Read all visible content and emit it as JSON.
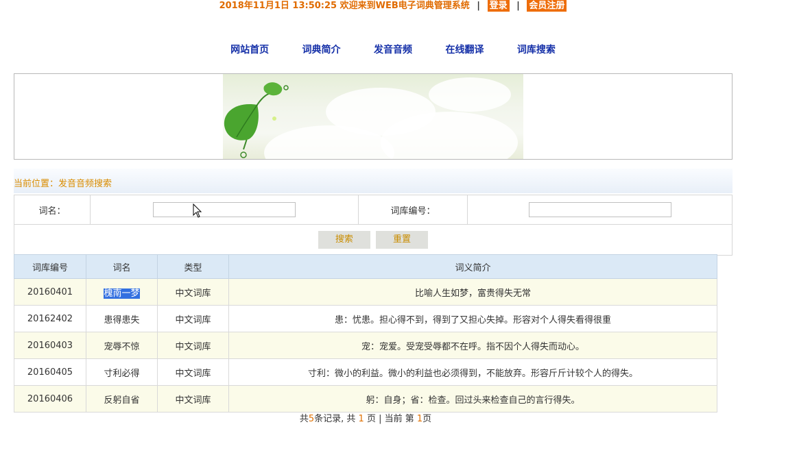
{
  "header": {
    "datetime": "2018年11月1日 13:50:25",
    "welcome": "欢迎来到WEB电子词典管理系统",
    "sep1": "|",
    "login": "登录",
    "sep2": "|",
    "register": "会员注册"
  },
  "nav": {
    "items": [
      "网站首页",
      "词典简介",
      "发音音频",
      "在线翻译",
      "词库搜索"
    ]
  },
  "breadcrumb": "当前位置：发音音频搜索",
  "search": {
    "word_label": "词名：",
    "word_value": "",
    "id_label": "词库编号：",
    "id_value": "",
    "search_button": "搜索",
    "reset_button": "重置"
  },
  "table": {
    "headers": [
      "词库编号",
      "词名",
      "类型",
      "词义简介"
    ],
    "rows": [
      [
        "20160401",
        "槐南一梦",
        "中文词库",
        "比喻人生如梦，富贵得失无常"
      ],
      [
        "20162402",
        "患得患失",
        "中文词库",
        "患：忧患。担心得不到，得到了又担心失掉。形容对个人得失看得很重"
      ],
      [
        "20160403",
        "宠辱不惊",
        "中文词库",
        "宠：宠爱。受宠受辱都不在呼。指不因个人得失而动心。"
      ],
      [
        "20160405",
        "寸利必得",
        "中文词库",
        "寸利：微小的利益。微小的利益也必须得到，不能放弃。形容斤斤计较个人的得失。"
      ],
      [
        "20160406",
        "反躬自省",
        "中文词库",
        "躬：自身；省：检查。回过头来检查自己的言行得失。"
      ]
    ]
  },
  "pager": {
    "p1": "共",
    "total": "5",
    "p2": "条记录, 共 ",
    "pages": "1",
    "p3": " 页 | 当前 第 ",
    "current": "1",
    "p4": "页"
  }
}
